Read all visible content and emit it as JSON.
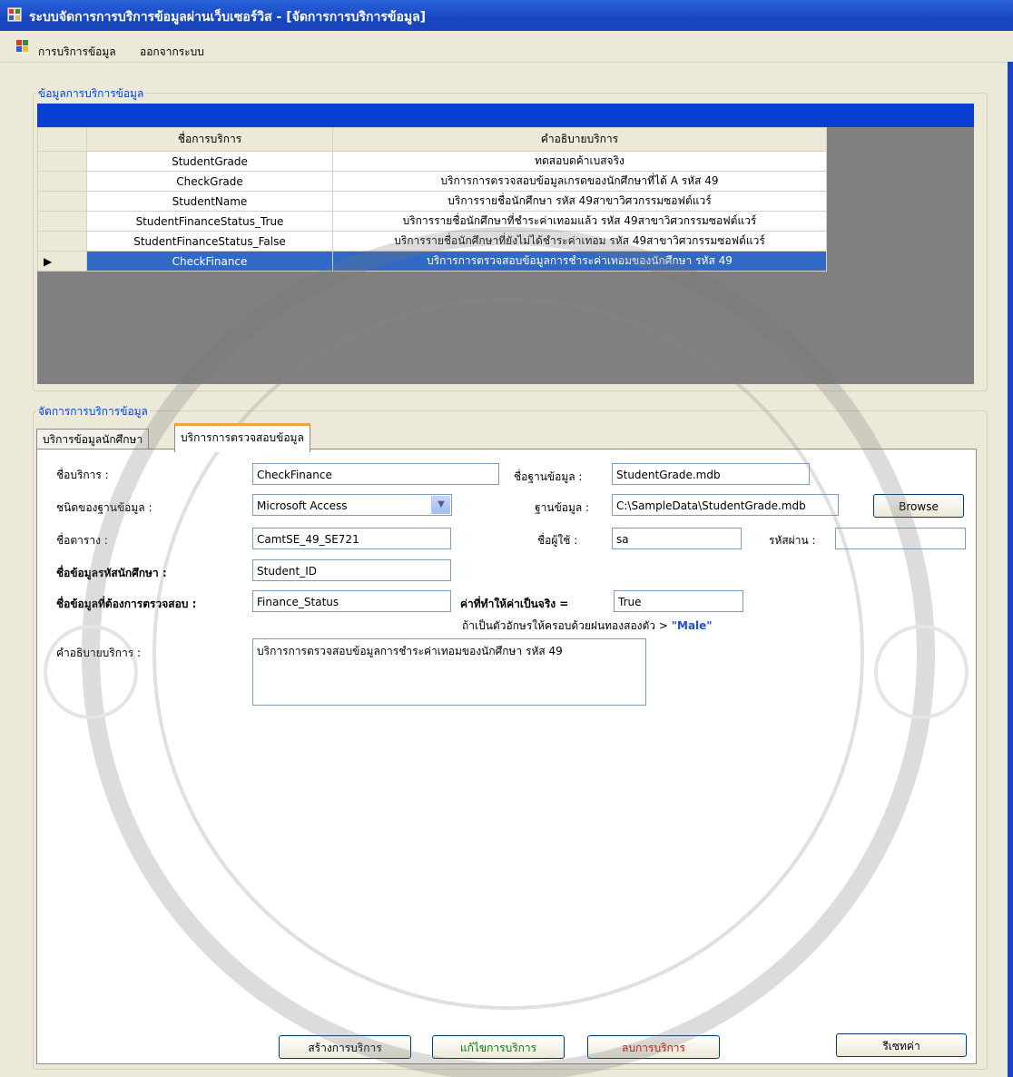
{
  "window": {
    "title": "ระบบจัดการการบริการข้อมูลผ่านเว็บเซอร์วิส - [จัดการการบริการข้อมูล]"
  },
  "menu": {
    "items": [
      "การบริการข้อมูล",
      "ออกจากระบบ"
    ]
  },
  "service_list_group": {
    "title": "ข้อมูลการบริการข้อมูล",
    "columns": [
      "ชื่อการบริการ",
      "คำอธิบายบริการ"
    ],
    "rows": [
      {
        "name": "StudentGrade",
        "description": "ทดสอบดค้าเบสจริง"
      },
      {
        "name": "CheckGrade",
        "description": "บริการการตรวจสอบข้อมูลเกรดของนักศึกษาที่ได้ A รหัส 49"
      },
      {
        "name": "StudentName",
        "description": "บริการรายชื่อนักศึกษา รหัส 49สาขาวิศวกรรมซอฟต์แวร์"
      },
      {
        "name": "StudentFinanceStatus_True",
        "description": "บริการรายชื่อนักศึกษาที่ชำระค่าเทอมแล้ว รหัส 49สาขาวิศวกรรมซอฟต์แวร์"
      },
      {
        "name": "StudentFinanceStatus_False",
        "description": "บริการรายชื่อนักศึกษาที่ยังไม่ได้ชำระค่าเทอม รหัส 49สาขาวิศวกรรมซอฟต์แวร์"
      },
      {
        "name": "CheckFinance",
        "description": "บริการการตรวจสอบข้อมูลการชำระค่าเทอมของนักศึกษา รหัส 49"
      }
    ],
    "selected_row_marker": "▶"
  },
  "manage_group": {
    "title": "จัดการการบริการข้อมูล",
    "tabs": [
      "บริการข้อมูลนักศึกษา",
      "บริการการตรวจสอบข้อมูล"
    ],
    "form": {
      "service_name_label": "ชื่อบริการ :",
      "service_name_value": "CheckFinance",
      "db_name_label": "ชื่อฐานข้อมูล :",
      "db_name_value": "StudentGrade.mdb",
      "db_type_label": "ชนิดของฐานข้อมูล :",
      "db_type_value": "Microsoft Access",
      "db_path_label": "ฐานข้อมูล :",
      "db_path_value": "C:\\SampleData\\StudentGrade.mdb",
      "browse_label": "Browse",
      "table_label": "ชื่อตาราง :",
      "table_value": "CamtSE_49_SE721",
      "user_label": "ชื่อผู้ใช้ :",
      "user_value": "sa",
      "password_label": "รหัสผ่าน :",
      "password_value": "",
      "student_id_field_label": "ชื่อข้อมูลรหัสนักศึกษา :",
      "student_id_field_value": "Student_ID",
      "check_field_label": "ชื่อข้อมูลที่ต้องการตรวจสอบ :",
      "check_field_value": "Finance_Status",
      "true_value_label": "ค่าที่ทำให้ค่าเป็นจริง =",
      "true_value_value": "True",
      "hint_text": "ถ้าเป็นตัวอักษรให้ครอบด้วยฝนทองสองตัว >",
      "hint_example": "\"Male\"",
      "description_label": "คำอธิบายบริการ :",
      "description_value": "บริการการตรวจสอบข้อมูลการชำระค่าเทอมของนักศึกษา รหัส 49"
    },
    "buttons": {
      "create": "สร้างการบริการ",
      "edit": "แก้ไขการบริการ",
      "delete": "ลบการบริการ",
      "reset": "รีเซทค่า"
    }
  },
  "colors": {
    "titlebar": "#1846c2",
    "selection": "#316ac5",
    "group_title": "#0046d5",
    "edit_button_text": "#008000",
    "delete_button_text": "#e00000"
  }
}
